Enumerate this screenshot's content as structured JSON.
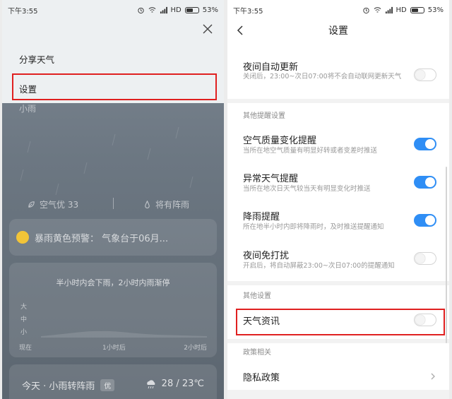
{
  "left": {
    "status": {
      "time": "下午3:55",
      "network": "HD",
      "battery": "53%"
    },
    "menu": {
      "share": "分享天气",
      "settings": "设置"
    },
    "weather": {
      "desc": "小雨",
      "air_quality": "空气优 33",
      "rain_notice": "将有阵雨",
      "warning": "暴雨黄色预警：        气象台于06月..."
    },
    "forecast": {
      "title": "半小时内会下雨，2小时内雨渐停",
      "levels": [
        "大",
        "中",
        "小"
      ],
      "axis": [
        "现在",
        "1小时后",
        "2小时后"
      ]
    },
    "today": {
      "summary": "今天 · 小雨转阵雨",
      "aq_badge": "优",
      "temp": "28 / 23℃"
    }
  },
  "right": {
    "status": {
      "time": "下午3:55",
      "network": "HD",
      "battery": "53%"
    },
    "title": "设置",
    "auto_update": {
      "title": "夜间自动更新",
      "sub": "关闭后，23:00~次日07:00将不会自动联网更新天气",
      "state": "off"
    },
    "other_reminders_header": "其他提醒设置",
    "reminders": [
      {
        "title": "空气质量变化提醒",
        "sub": "当所在地空气质量有明显好转或者变差时推送",
        "state": "on"
      },
      {
        "title": "异常天气提醒",
        "sub": "当所在地次日天气较当天有明显变化时推送",
        "state": "on"
      },
      {
        "title": "降雨提醒",
        "sub": "所在地半小时内即将降雨时，及时推送提醒通知",
        "state": "on"
      },
      {
        "title": "夜间免打扰",
        "sub": "开启后，将自动屏蔽23:00~次日07:00的提醒通知",
        "state": "off"
      }
    ],
    "other_settings_header": "其他设置",
    "weather_news": {
      "title": "天气资讯",
      "state": "off"
    },
    "policy_header": "政策相关",
    "privacy": {
      "title": "隐私政策"
    }
  },
  "colors": {
    "accent": "#2f8ef5",
    "highlight": "#e02020"
  }
}
